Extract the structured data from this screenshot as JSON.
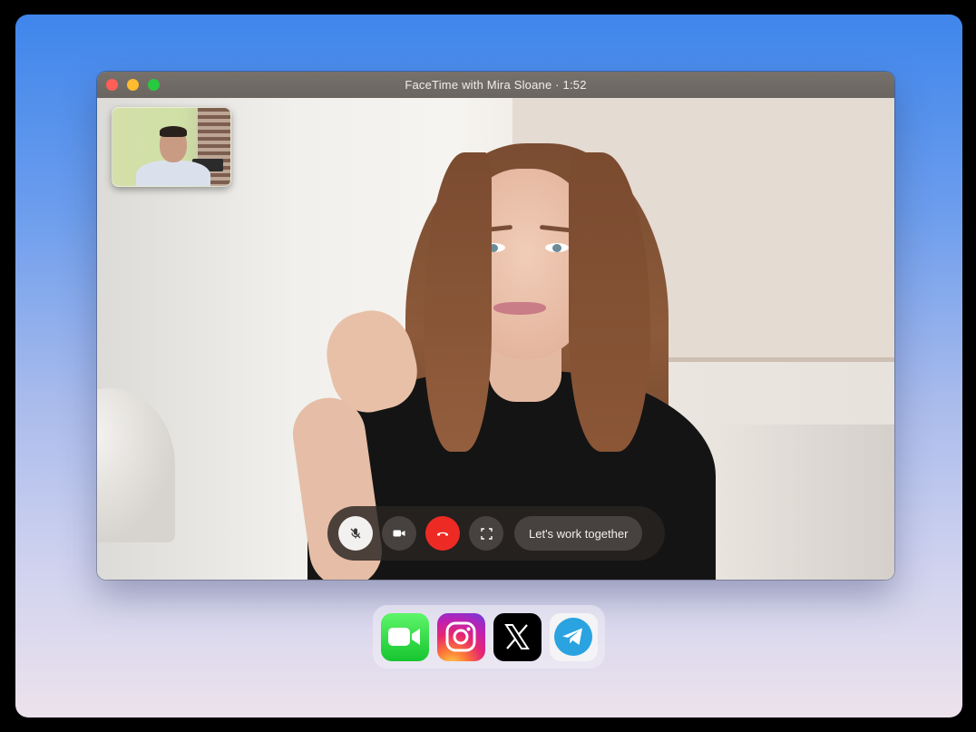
{
  "window": {
    "title": "FaceTime with Mira Sloane · 1:52"
  },
  "controls": {
    "buttons": [
      {
        "name": "mute",
        "icon": "mic-off-icon"
      },
      {
        "name": "camera",
        "icon": "video-camera-icon"
      },
      {
        "name": "end-call",
        "icon": "phone-hangup-icon"
      },
      {
        "name": "fullscreen",
        "icon": "fullscreen-icon"
      }
    ],
    "cta_label": "Let's work together"
  },
  "dock": {
    "apps": [
      {
        "name": "FaceTime",
        "icon": "facetime-icon"
      },
      {
        "name": "Instagram",
        "icon": "instagram-icon"
      },
      {
        "name": "X",
        "icon": "x-logo-icon"
      },
      {
        "name": "Telegram",
        "icon": "telegram-icon"
      }
    ]
  },
  "colors": {
    "end_call": "#ee2a24",
    "traffic_red": "#fe5f57",
    "traffic_yellow": "#febc2e",
    "traffic_green": "#28c840"
  }
}
